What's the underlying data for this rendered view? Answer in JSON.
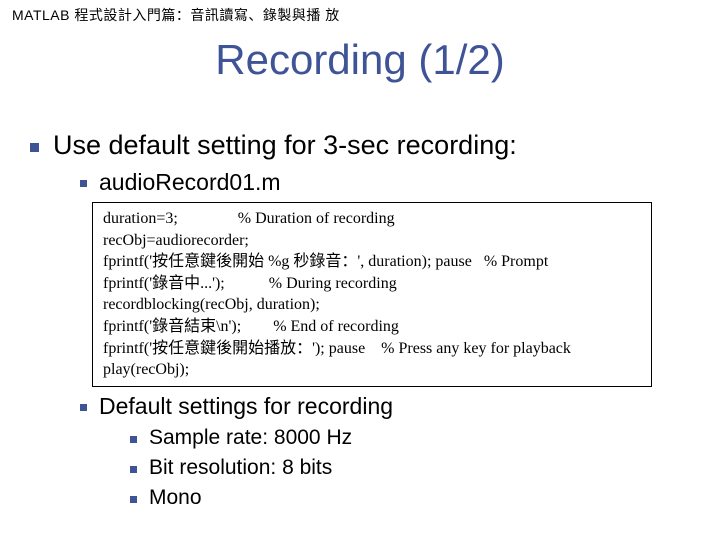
{
  "header": "MATLAB 程式設計入門篇：音訊讀寫、錄製與播 放",
  "title": "Recording (1/2)",
  "bullets": [
    {
      "level": 1,
      "text": "Use default setting for 3-sec recording:"
    },
    {
      "level": 2,
      "text": "audioRecord01.m"
    },
    {
      "level": 2,
      "text": "Default settings for recording"
    },
    {
      "level": 3,
      "text": "Sample rate: 8000 Hz"
    },
    {
      "level": 3,
      "text": "Bit resolution: 8 bits"
    },
    {
      "level": 3,
      "text": "Mono"
    }
  ],
  "code": [
    "duration=3;               % Duration of recording",
    "recObj=audiorecorder;",
    "fprintf('按任意鍵後開始 %g 秒錄音：', duration); pause   % Prompt",
    "fprintf('錄音中...');           % During recording",
    "recordblocking(recObj, duration);",
    "fprintf('錄音結束\\n');        % End of recording",
    "fprintf('按任意鍵後開始播放：'); pause    % Press any key for playback",
    "play(recObj);"
  ]
}
